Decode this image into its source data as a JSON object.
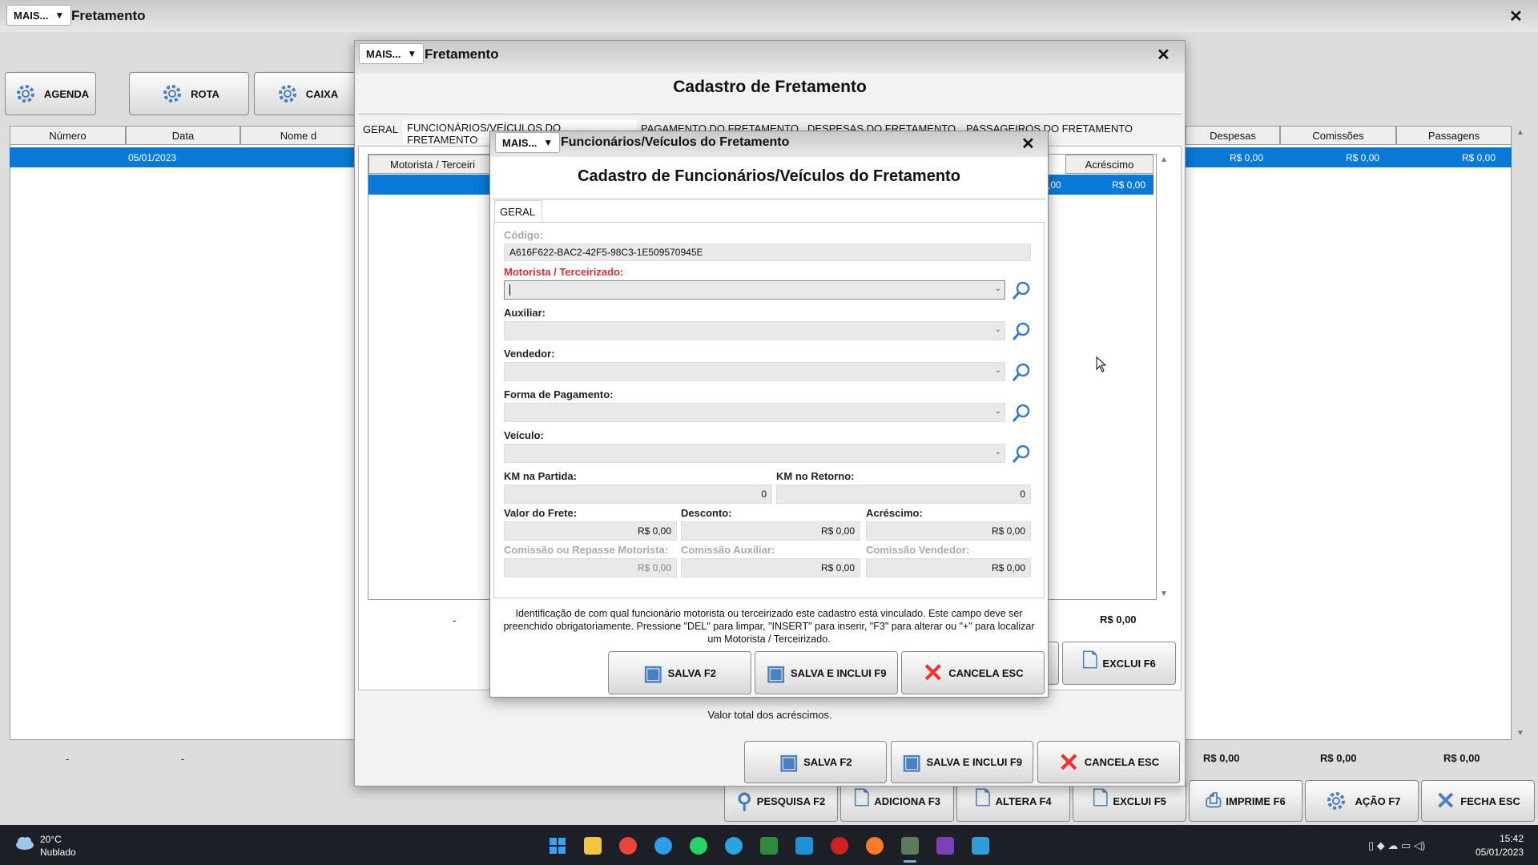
{
  "main": {
    "mais_label": "MAIS...",
    "title": "Fretamento",
    "close": "✕",
    "toolbar": [
      {
        "label": "AGENDA"
      },
      {
        "label": "ROTA"
      },
      {
        "label": "CAIXA"
      }
    ],
    "grid_headers_left": [
      "Número",
      "Data",
      "Nome d"
    ],
    "grid_headers_right": [
      "Despesas",
      "Comissões",
      "Passagens"
    ],
    "selected_row": {
      "date": "05/01/2023",
      "despesas": "R$ 0,00",
      "comissoes": "R$ 0,00",
      "passagens": "R$ 0,00"
    },
    "footer_left": [
      "-",
      "-"
    ],
    "footer_right": [
      "R$ 0,00",
      "R$ 0,00",
      "R$ 0,00"
    ],
    "bottom_buttons": [
      "PESQUISA F2",
      "ADICIONA F3",
      "ALTERA F4",
      "EXCLUI F5",
      "IMPRIME F6",
      "AÇÃO F7",
      "FECHA ESC"
    ]
  },
  "mid": {
    "mais_label": "MAIS...",
    "title": "Fretamento",
    "close": "✕",
    "heading": "Cadastro de Fretamento",
    "tabs": [
      "GERAL",
      "FUNCIONÁRIOS/VEÍCULOS DO FRETAMENTO",
      "PAGAMENTO DO FRETAMENTO",
      "DESPESAS DO FRETAMENTO",
      "PASSAGEIROS DO FRETAMENTO"
    ],
    "inner_headers": [
      "Motorista / Terceiri",
      "Acréscimo"
    ],
    "inner_row_values": [
      ",00",
      "R$ 0,00"
    ],
    "summary_dash": "-",
    "summary_value": "R$ 0,00",
    "exclui_label": "EXCLUI F6",
    "hint": "Valor total dos acréscimos.",
    "buttons": [
      "SALVA F2",
      "SALVA E INCLUI F9",
      "CANCELA ESC"
    ]
  },
  "dialog": {
    "mais_label": "MAIS...",
    "title": "Funcionários/Veículos do Fretamento",
    "close": "✕",
    "heading": "Cadastro de Funcionários/Veículos do Fretamento",
    "tab": "GERAL",
    "codigo_label": "Código:",
    "codigo_value": "A616F622-BAC2-42F5-98C3-1E509570945E",
    "motorista_label": "Motorista / Terceirizado:",
    "auxiliar_label": "Auxiliar:",
    "vendedor_label": "Vendedor:",
    "forma_label": "Forma de Pagamento:",
    "veiculo_label": "Veículo:",
    "km_partida_label": "KM na Partida:",
    "km_partida_value": "0",
    "km_retorno_label": "KM no Retorno:",
    "km_retorno_value": "0",
    "valor_frete_label": "Valor do Frete:",
    "valor_frete_value": "R$ 0,00",
    "desconto_label": "Desconto:",
    "desconto_value": "R$ 0,00",
    "acrescimo_label": "Acréscimo:",
    "acrescimo_value": "R$ 0,00",
    "comissao_motorista_label": "Comissão ou Repasse Motorista:",
    "comissao_motorista_value": "R$ 0,00",
    "comissao_auxiliar_label": "Comissão Auxiliar:",
    "comissao_auxiliar_value": "R$ 0,00",
    "comissao_vendedor_label": "Comissão Vendedor:",
    "comissao_vendedor_value": "R$ 0,00",
    "help_text": "Identificação de com qual funcionário motorista ou terceirizado este cadastro está vinculado. Este campo deve ser preenchido obrigatoriamente. Pressione \"DEL\" para limpar, \"INSERT\" para inserir, \"F3\" para alterar ou \"+\" para localizar um Motorista / Terceirizado.",
    "buttons": [
      "SALVA F2",
      "SALVA E INCLUI F9",
      "CANCELA ESC"
    ]
  },
  "taskbar": {
    "weather_temp": "20°C",
    "weather_desc": "Nublado",
    "time": "15:42",
    "date": "05/01/2023"
  }
}
